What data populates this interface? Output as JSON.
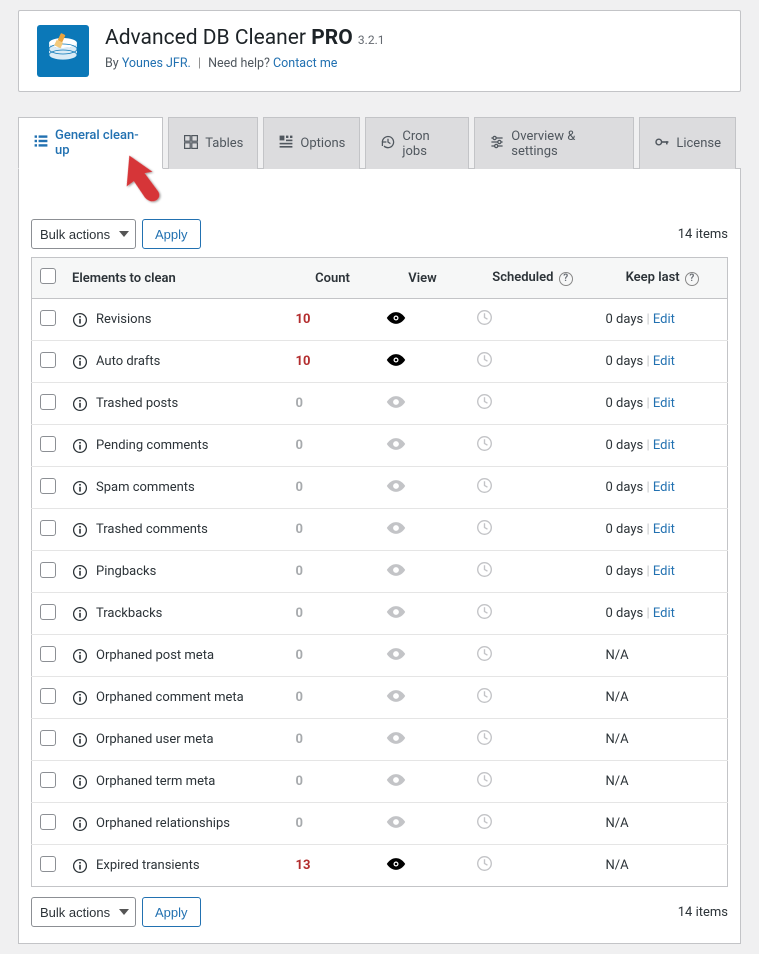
{
  "header": {
    "title_pre": "Advanced DB Cleaner ",
    "title_pro": "PRO",
    "version": "3.2.1",
    "by_prefix": "By ",
    "author": "Younes JFR.",
    "help_text": "Need help?",
    "contact": "Contact me"
  },
  "tabs": {
    "cleanup": "General clean-up",
    "tables": "Tables",
    "options": "Options",
    "cron": "Cron jobs",
    "overview": "Overview & settings",
    "license": "License"
  },
  "actions": {
    "bulk": "Bulk actions",
    "apply": "Apply",
    "items_count": "14 items"
  },
  "table": {
    "headers": {
      "elements": "Elements to clean",
      "count": "Count",
      "view": "View",
      "scheduled": "Scheduled",
      "keep": "Keep last"
    },
    "keep_days": "0 days",
    "edit": "Edit",
    "na": "N/A",
    "rows": [
      {
        "label": "Revisions",
        "count": "10",
        "active": true,
        "keep": "edit"
      },
      {
        "label": "Auto drafts",
        "count": "10",
        "active": true,
        "keep": "edit"
      },
      {
        "label": "Trashed posts",
        "count": "0",
        "active": false,
        "keep": "edit"
      },
      {
        "label": "Pending comments",
        "count": "0",
        "active": false,
        "keep": "edit"
      },
      {
        "label": "Spam comments",
        "count": "0",
        "active": false,
        "keep": "edit"
      },
      {
        "label": "Trashed comments",
        "count": "0",
        "active": false,
        "keep": "edit"
      },
      {
        "label": "Pingbacks",
        "count": "0",
        "active": false,
        "keep": "edit"
      },
      {
        "label": "Trackbacks",
        "count": "0",
        "active": false,
        "keep": "edit"
      },
      {
        "label": "Orphaned post meta",
        "count": "0",
        "active": false,
        "keep": "na"
      },
      {
        "label": "Orphaned comment meta",
        "count": "0",
        "active": false,
        "keep": "na"
      },
      {
        "label": "Orphaned user meta",
        "count": "0",
        "active": false,
        "keep": "na"
      },
      {
        "label": "Orphaned term meta",
        "count": "0",
        "active": false,
        "keep": "na"
      },
      {
        "label": "Orphaned relationships",
        "count": "0",
        "active": false,
        "keep": "na"
      },
      {
        "label": "Expired transients",
        "count": "13",
        "active": true,
        "keep": "na"
      }
    ]
  }
}
